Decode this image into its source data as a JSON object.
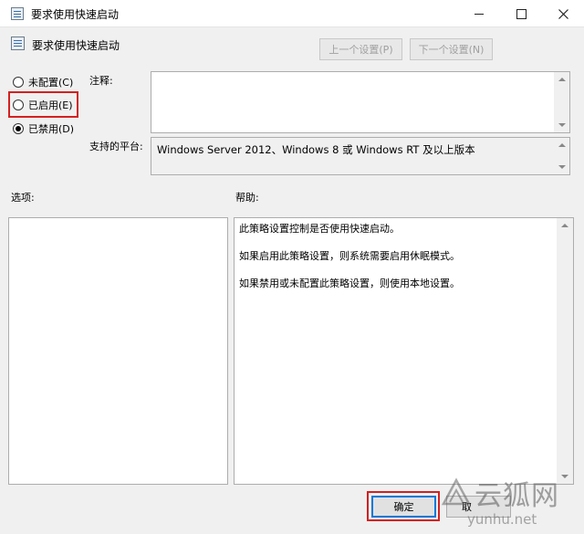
{
  "window": {
    "title": "要求使用快速启动"
  },
  "header": {
    "title": "要求使用快速启动",
    "prev_label": "上一个设置(P)",
    "next_label": "下一个设置(N)"
  },
  "state": {
    "options": [
      {
        "label": "未配置(C)",
        "checked": false
      },
      {
        "label": "已启用(E)",
        "checked": false
      },
      {
        "label": "已禁用(D)",
        "checked": true
      }
    ]
  },
  "comment": {
    "label": "注释:",
    "value": ""
  },
  "platform": {
    "label": "支持的平台:",
    "value": "Windows Server 2012、Windows 8 或 Windows RT 及以上版本"
  },
  "options_panel": {
    "label": "选项:"
  },
  "help_panel": {
    "label": "帮助:",
    "paragraphs": [
      "此策略设置控制是否使用快速启动。",
      "如果启用此策略设置，则系统需要启用休眠模式。",
      "如果禁用或未配置此策略设置，则使用本地设置。"
    ]
  },
  "buttons": {
    "ok": "确定",
    "cancel": "取"
  },
  "watermark": {
    "text": "云狐网",
    "url": "yunhu.net"
  },
  "colors": {
    "highlight": "#d42020",
    "focus": "#0078d7"
  }
}
